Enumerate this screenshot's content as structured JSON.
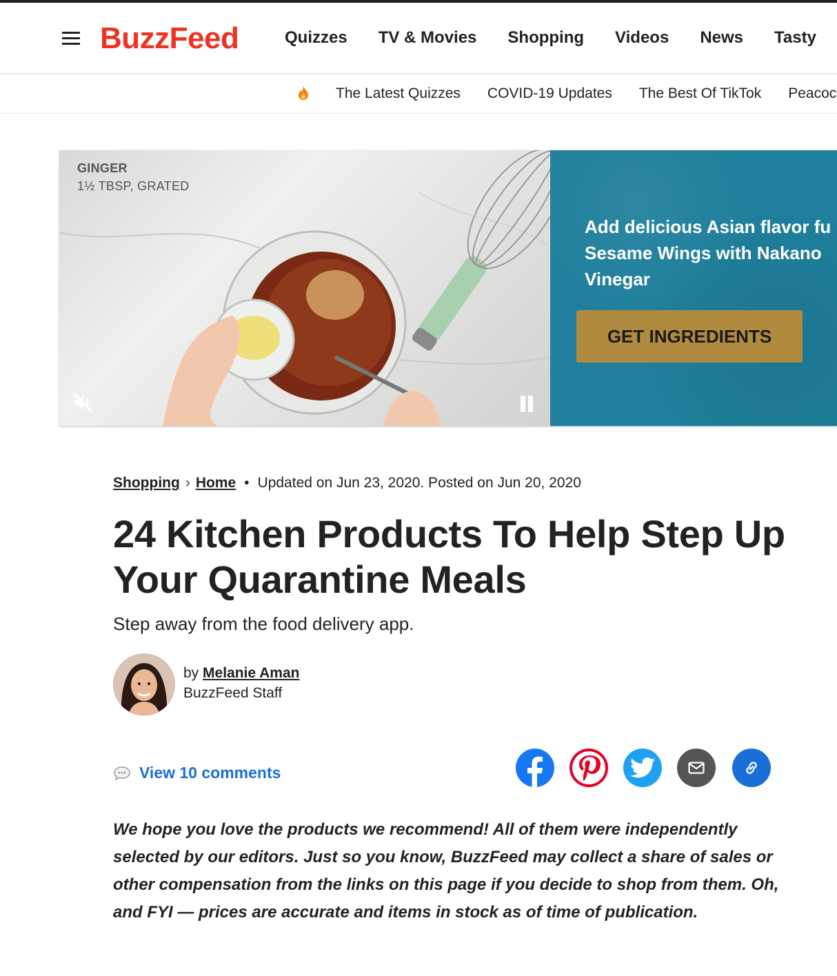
{
  "header": {
    "logo": "BuzzFeed",
    "nav": [
      "Quizzes",
      "TV & Movies",
      "Shopping",
      "Videos",
      "News",
      "Tasty"
    ],
    "logo_color": "#ee3322"
  },
  "subnav": {
    "items": [
      "The Latest Quizzes",
      "COVID-19 Updates",
      "The Best Of TikTok",
      "Peacock"
    ]
  },
  "ad": {
    "label_ingredient": "GINGER",
    "label_amount": "1½ TBSP, GRATED",
    "headline": "Add delicious Asian flavor fu\nSesame Wings with Nakano\nVinegar",
    "cta": "GET INGREDIENTS",
    "panel_color": "#1f7f9c",
    "cta_color": "#b08a3e"
  },
  "article": {
    "crumb_1": "Shopping",
    "crumb_2": "Home",
    "dates": "Updated on Jun 23, 2020. Posted on Jun 20, 2020",
    "title": "24 Kitchen Products To Help Step Up Your Quarantine Meals",
    "dek": "Step away from the food delivery app.",
    "by": "by",
    "author": "Melanie Aman",
    "author_role": "BuzzFeed Staff",
    "comments": "View 10 comments",
    "disclaimer": "We hope you love the products we recommend! All of them were independently selected by our editors. Just so you know, BuzzFeed may collect a share of sales or other compensation from the links on this page if you decide to shop from them. Oh, and FYI — prices are accurate and items in stock as of time of publication."
  },
  "share": {
    "facebook_color": "#1877f2",
    "pinterest_color": "#e60023",
    "twitter_color": "#1da1f2",
    "email_color": "#555555",
    "link_color": "#1a6fd6"
  }
}
